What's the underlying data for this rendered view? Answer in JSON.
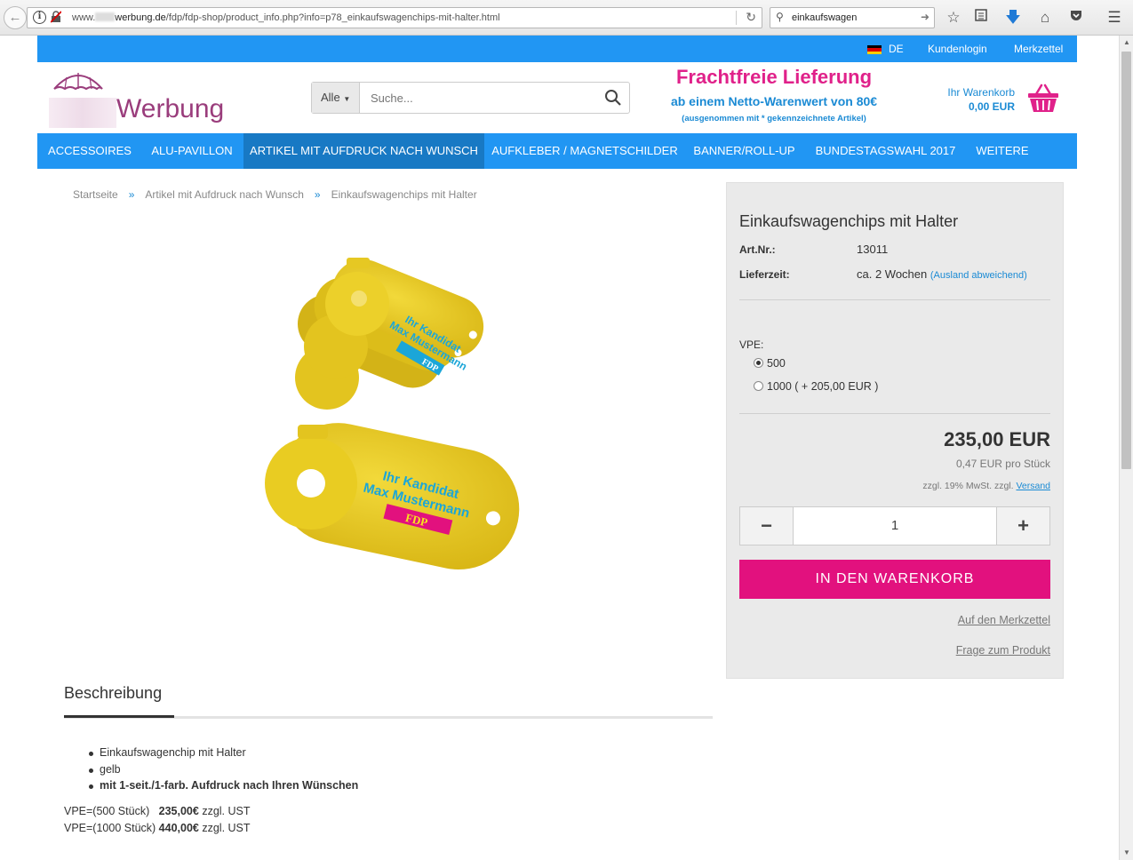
{
  "browser": {
    "url_prefix": "www.",
    "url_host": "werbung.de",
    "url_path": "/fdp/fdp-shop/product_info.php?info=p78_einkaufswagenchips-mit-halter.html",
    "search_value": "einkaufswagen"
  },
  "topbar": {
    "language": "DE",
    "login": "Kundenlogin",
    "wishlist": "Merkzettel"
  },
  "logo": {
    "text": "Werbung"
  },
  "search": {
    "category": "Alle",
    "placeholder": "Suche..."
  },
  "promo": {
    "title": "Frachtfreie Lieferung",
    "subtitle": "ab einem Netto-Warenwert von 80€",
    "note": "(ausgenommen mit * gekennzeichnete Artikel)"
  },
  "cart": {
    "label": "Ihr Warenkorb",
    "total": "0,00 EUR"
  },
  "nav": {
    "items": [
      "ACCESSOIRES",
      "ALU-PAVILLON",
      "ARTIKEL MIT AUFDRUCK NACH WUNSCH",
      "AUFKLEBER / MAGNETSCHILDER",
      "BANNER/ROLL-UP",
      "BUNDESTAGSWAHL 2017",
      "WEITERE"
    ]
  },
  "breadcrumb": {
    "separator": "»",
    "items": [
      "Startseite",
      "Artikel mit Aufdruck nach Wunsch",
      "Einkaufswagenchips mit Halter"
    ]
  },
  "image": {
    "line1": "Ihr Kandidat",
    "line2": "Max Mustermann",
    "party": "FDP",
    "colors": {
      "chip": "#e8c820",
      "text": "#1ba6d8",
      "party_bg": "#e2117e"
    }
  },
  "product": {
    "title": "Einkaufswagenchips mit Halter",
    "art_label": "Art.Nr.:",
    "art_value": "13011",
    "delivery_label": "Lieferzeit:",
    "delivery_value": "ca. 2 Wochen",
    "delivery_note": "(Ausland abweichend)",
    "vpe_label": "VPE:",
    "vpe_options": [
      "500",
      "1000 ( + 205,00 EUR )"
    ],
    "vpe_selected": "500",
    "price": "235,00 EUR",
    "unit_price": "0,47 EUR pro Stück",
    "tax_prefix": "zzgl. 19% MwSt. zzgl.",
    "tax_link": "Versand",
    "qty_minus": "−",
    "qty_value": "1",
    "qty_plus": "+",
    "cart_button": "IN DEN WARENKORB",
    "wishlist_link": "Auf den Merkzettel",
    "question_link": "Frage zum Produkt"
  },
  "description": {
    "tab": "Beschreibung",
    "bullets": [
      "Einkaufswagenchip mit Halter",
      "gelb",
      "mit 1-seit./1-farb. Aufdruck nach Ihren Wünschen"
    ],
    "vpe_lines": [
      {
        "label": "VPE=(500 Stück)",
        "price": "235,00€",
        "suffix": "zzgl. UST"
      },
      {
        "label": "VPE=(1000 Stück)",
        "price": "440,00€",
        "suffix": "zzgl. UST"
      }
    ]
  },
  "colors": {
    "blue": "#2196f3",
    "nav_active": "#1879c4",
    "pink": "#e2117e",
    "link_blue": "#1a8ad4"
  }
}
